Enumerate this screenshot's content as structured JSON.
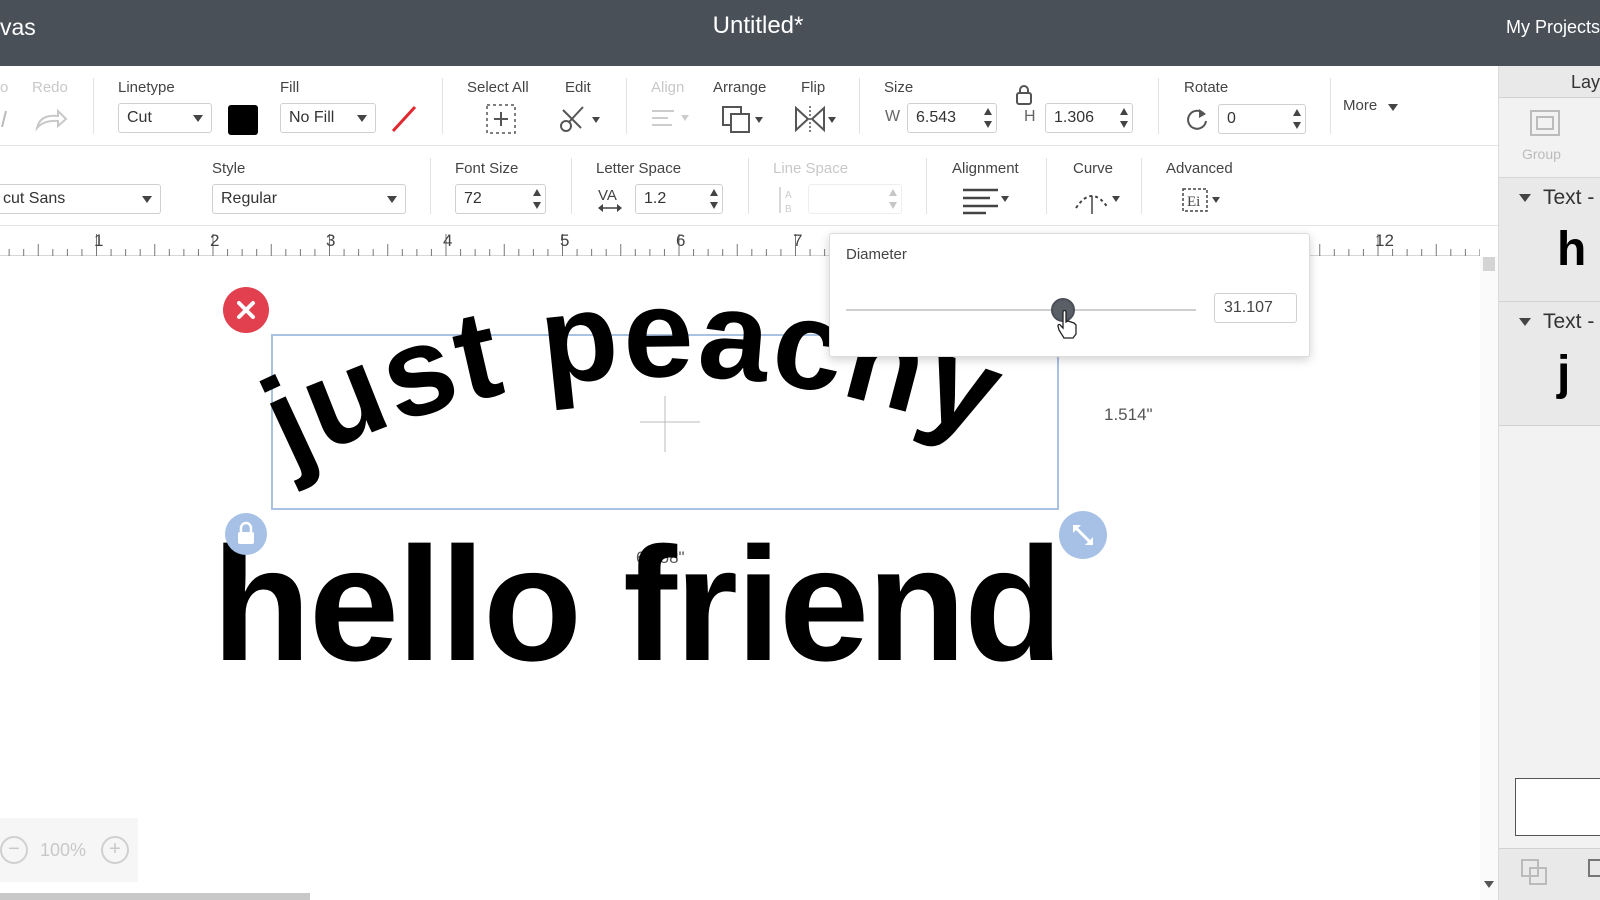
{
  "header": {
    "left_title": "vas",
    "doc_title": "Untitled*",
    "projects_link": "My Projects"
  },
  "toolbar_row1": {
    "undo_label": "o",
    "redo_label": "Redo",
    "linetype_label": "Linetype",
    "linetype_value": "Cut",
    "fill_label": "Fill",
    "fill_value": "No Fill",
    "select_all_label": "Select All",
    "edit_label": "Edit",
    "align_label": "Align",
    "arrange_label": "Arrange",
    "flip_label": "Flip",
    "size_label": "Size",
    "w_label": "W",
    "w_value": "6.543",
    "h_label": "H",
    "h_value": "1.306",
    "rotate_label": "Rotate",
    "rotate_value": "0",
    "more_label": "More",
    "linetype_color": "#000000",
    "pen_color": "#e0282e"
  },
  "toolbar_row2": {
    "font_value": "cut Sans",
    "style_label": "Style",
    "style_value": "Regular",
    "font_size_label": "Font Size",
    "font_size_value": "72",
    "letter_space_label": "Letter Space",
    "letter_space_value": "1.2",
    "line_space_label": "Line Space",
    "alignment_label": "Alignment",
    "curve_label": "Curve",
    "advanced_label": "Advanced"
  },
  "ruler": {
    "numbers": [
      "1",
      "2",
      "3",
      "4",
      "5",
      "6",
      "7",
      "12"
    ]
  },
  "canvas": {
    "curved_text": "just peachy",
    "straight_text": "hello friend",
    "width_dimension": "6.758\"",
    "height_dimension": "1.514\""
  },
  "diameter_popup": {
    "title": "Diameter",
    "value": "31.107",
    "slider_fraction": 0.62
  },
  "layers_panel": {
    "header": "Lay",
    "group_label": "Group",
    "layers": [
      {
        "name": "Text -",
        "preview": "h"
      },
      {
        "name": "Text -",
        "preview": "j"
      }
    ]
  },
  "zoom": {
    "minus": "−",
    "value": "100%",
    "plus": "+"
  },
  "colors": {
    "delete_handle": "#e2404f",
    "handle_blue": "#a7c1e6",
    "topbar": "#4a5058"
  }
}
